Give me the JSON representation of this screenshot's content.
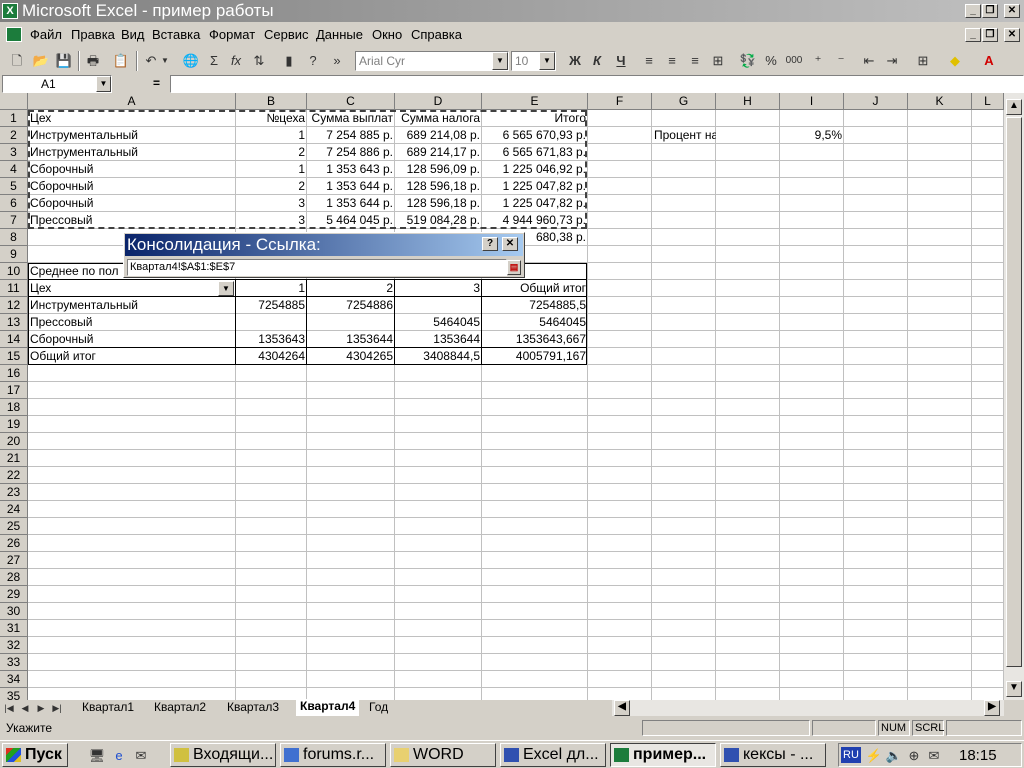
{
  "window": {
    "title": "Microsoft Excel - пример работы",
    "app_icon": "excel-icon"
  },
  "menu": [
    "Файл",
    "Правка",
    "Вид",
    "Вставка",
    "Формат",
    "Сервис",
    "Данные",
    "Окно",
    "Справка"
  ],
  "toolbar": {
    "font": "Arial Cyr",
    "size": "10",
    "bold": "Ж",
    "italic": "К",
    "underline": "Ч",
    "sum": "Σ",
    "fx": "fx",
    "percent": "%",
    "thousands": "000",
    "more": "»"
  },
  "formula": {
    "namebox": "A1",
    "equals": "="
  },
  "columns": [
    "A",
    "B",
    "C",
    "D",
    "E",
    "F",
    "G",
    "H",
    "I",
    "J",
    "K",
    "L"
  ],
  "rows": [
    "1",
    "2",
    "3",
    "4",
    "5",
    "6",
    "7",
    "8",
    "9",
    "10",
    "11",
    "12",
    "13",
    "14",
    "15",
    "16",
    "17",
    "18",
    "19",
    "20",
    "21",
    "22",
    "23",
    "24",
    "25",
    "26",
    "27",
    "28",
    "29",
    "30",
    "31",
    "32",
    "33",
    "34",
    "35"
  ],
  "cells": {
    "A1": "Цех",
    "B1": "№цеха",
    "C1": "Сумма выплат",
    "D1": "Сумма налога",
    "E1": "Итого",
    "A2": "Инструментальный",
    "B2": "1",
    "C2": "7 254 885 р.",
    "D2": "689 214,08 р.",
    "E2": "6 565 670,93 р.",
    "A3": "Инструментальный",
    "B3": "2",
    "C3": "7 254 886 р.",
    "D3": "689 214,17 р.",
    "E3": "6 565 671,83 р.",
    "A4": "Сборочный",
    "B4": "1",
    "C4": "1 353 643 р.",
    "D4": "128 596,09 р.",
    "E4": "1 225 046,92 р.",
    "A5": "Сборочный",
    "B5": "2",
    "C5": "1 353 644 р.",
    "D5": "128 596,18 р.",
    "E5": "1 225 047,82 р.",
    "A6": "Сборочный",
    "B6": "3",
    "C6": "1 353 644 р.",
    "D6": "128 596,18 р.",
    "E6": "1 225 047,82 р.",
    "A7": "Прессовый",
    "B7": "3",
    "C7": "5 464 045 р.",
    "D7": "519 084,28 р.",
    "E7": "4 944 960,73 р.",
    "E8": "680,38 р.",
    "A10": "Среднее по пол",
    "A11": "Цех",
    "B11": "1",
    "C11": "2",
    "D11": "3",
    "E11": "Общий итог",
    "A12": "Инструментальный",
    "B12": "7254885",
    "C12": "7254886",
    "E12": "7254885,5",
    "A13": "Прессовый",
    "D13": "5464045",
    "E13": "5464045",
    "A14": "Сборочный",
    "B14": "1353643",
    "C14": "1353644",
    "D14": "1353644",
    "E14": "1353643,667",
    "A15": "Общий итог",
    "B15": "4304264",
    "C15": "4304265",
    "D15": "3408844,5",
    "E15": "4005791,167",
    "G2": "Процент налога",
    "I2": "9,5%"
  },
  "dialog": {
    "title": "Консолидация - Ссылка:",
    "reference": "Квартал4!$A$1:$E$7",
    "help": "?",
    "close": "✕"
  },
  "sheets": [
    "Квартал1",
    "Квартал2",
    "Квартал3",
    "Квартал4",
    "Год"
  ],
  "active_sheet": "Квартал4",
  "status": {
    "mode": "Укажите",
    "num": "NUM",
    "scrl": "SCRL"
  },
  "taskbar": {
    "start": "Пуск",
    "items": [
      "Входящи...",
      "forums.r...",
      "WORD",
      "Excel дл...",
      "пример...",
      "кексы - ..."
    ],
    "active": "пример...",
    "lang": "RU",
    "clock": "18:15"
  },
  "colors": {
    "titlebar_inactive": "#808080",
    "dialog_title": "#0a246a",
    "face": "#d4d0c8"
  }
}
